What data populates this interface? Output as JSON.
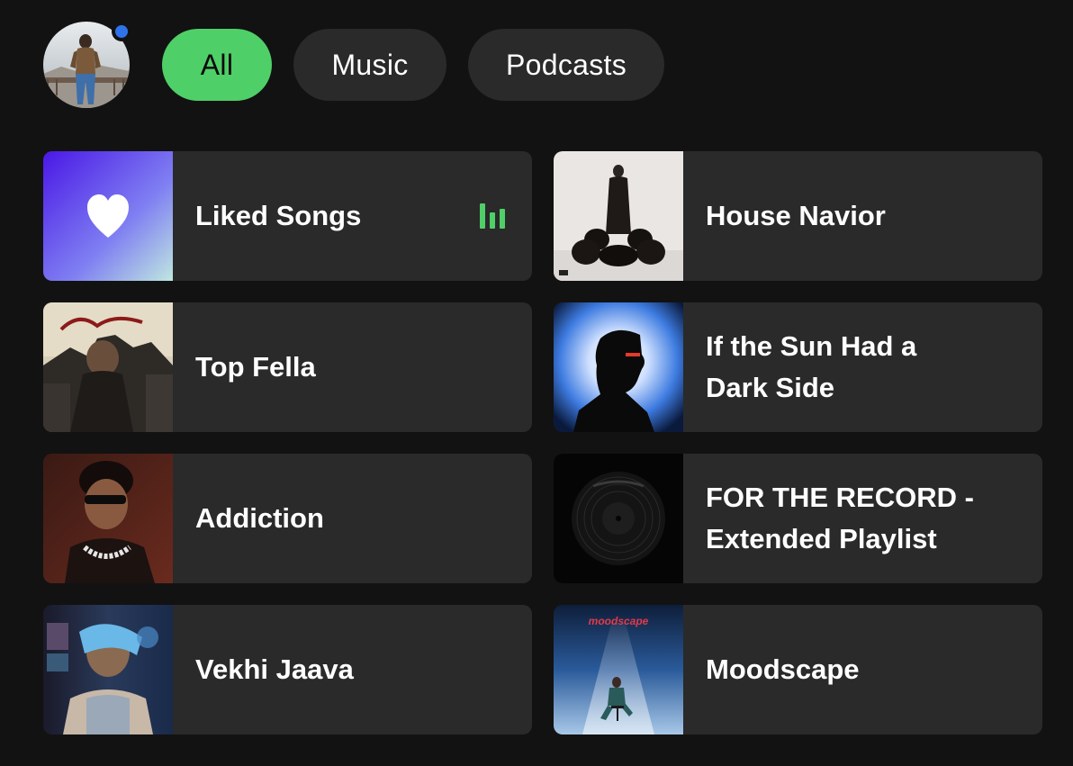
{
  "avatar": {
    "icon": "user-avatar",
    "notification_color": "#2f73ea"
  },
  "filters": {
    "active_color": "#4fcf68",
    "chips": [
      {
        "label": "All",
        "active": true
      },
      {
        "label": "Music",
        "active": false
      },
      {
        "label": "Podcasts",
        "active": false
      }
    ]
  },
  "library": {
    "items": [
      {
        "title": "Liked Songs",
        "artwork": "heart-icon",
        "now_playing": true
      },
      {
        "title": "House Navior",
        "artwork": "album-art"
      },
      {
        "title": "Top Fella",
        "artwork": "album-art"
      },
      {
        "title": "If the Sun Had a Dark Side",
        "artwork": "album-art"
      },
      {
        "title": "Addiction",
        "artwork": "album-art"
      },
      {
        "title": "FOR THE RECORD - Extended Playlist",
        "artwork": "vinyl-record-art"
      },
      {
        "title": "Vekhi Jaava",
        "artwork": "album-art"
      },
      {
        "title": "Moodscape",
        "artwork": "album-art"
      }
    ],
    "moodscape_cover_text": "moodscape",
    "now_playing_icon": "equalizer-icon"
  }
}
